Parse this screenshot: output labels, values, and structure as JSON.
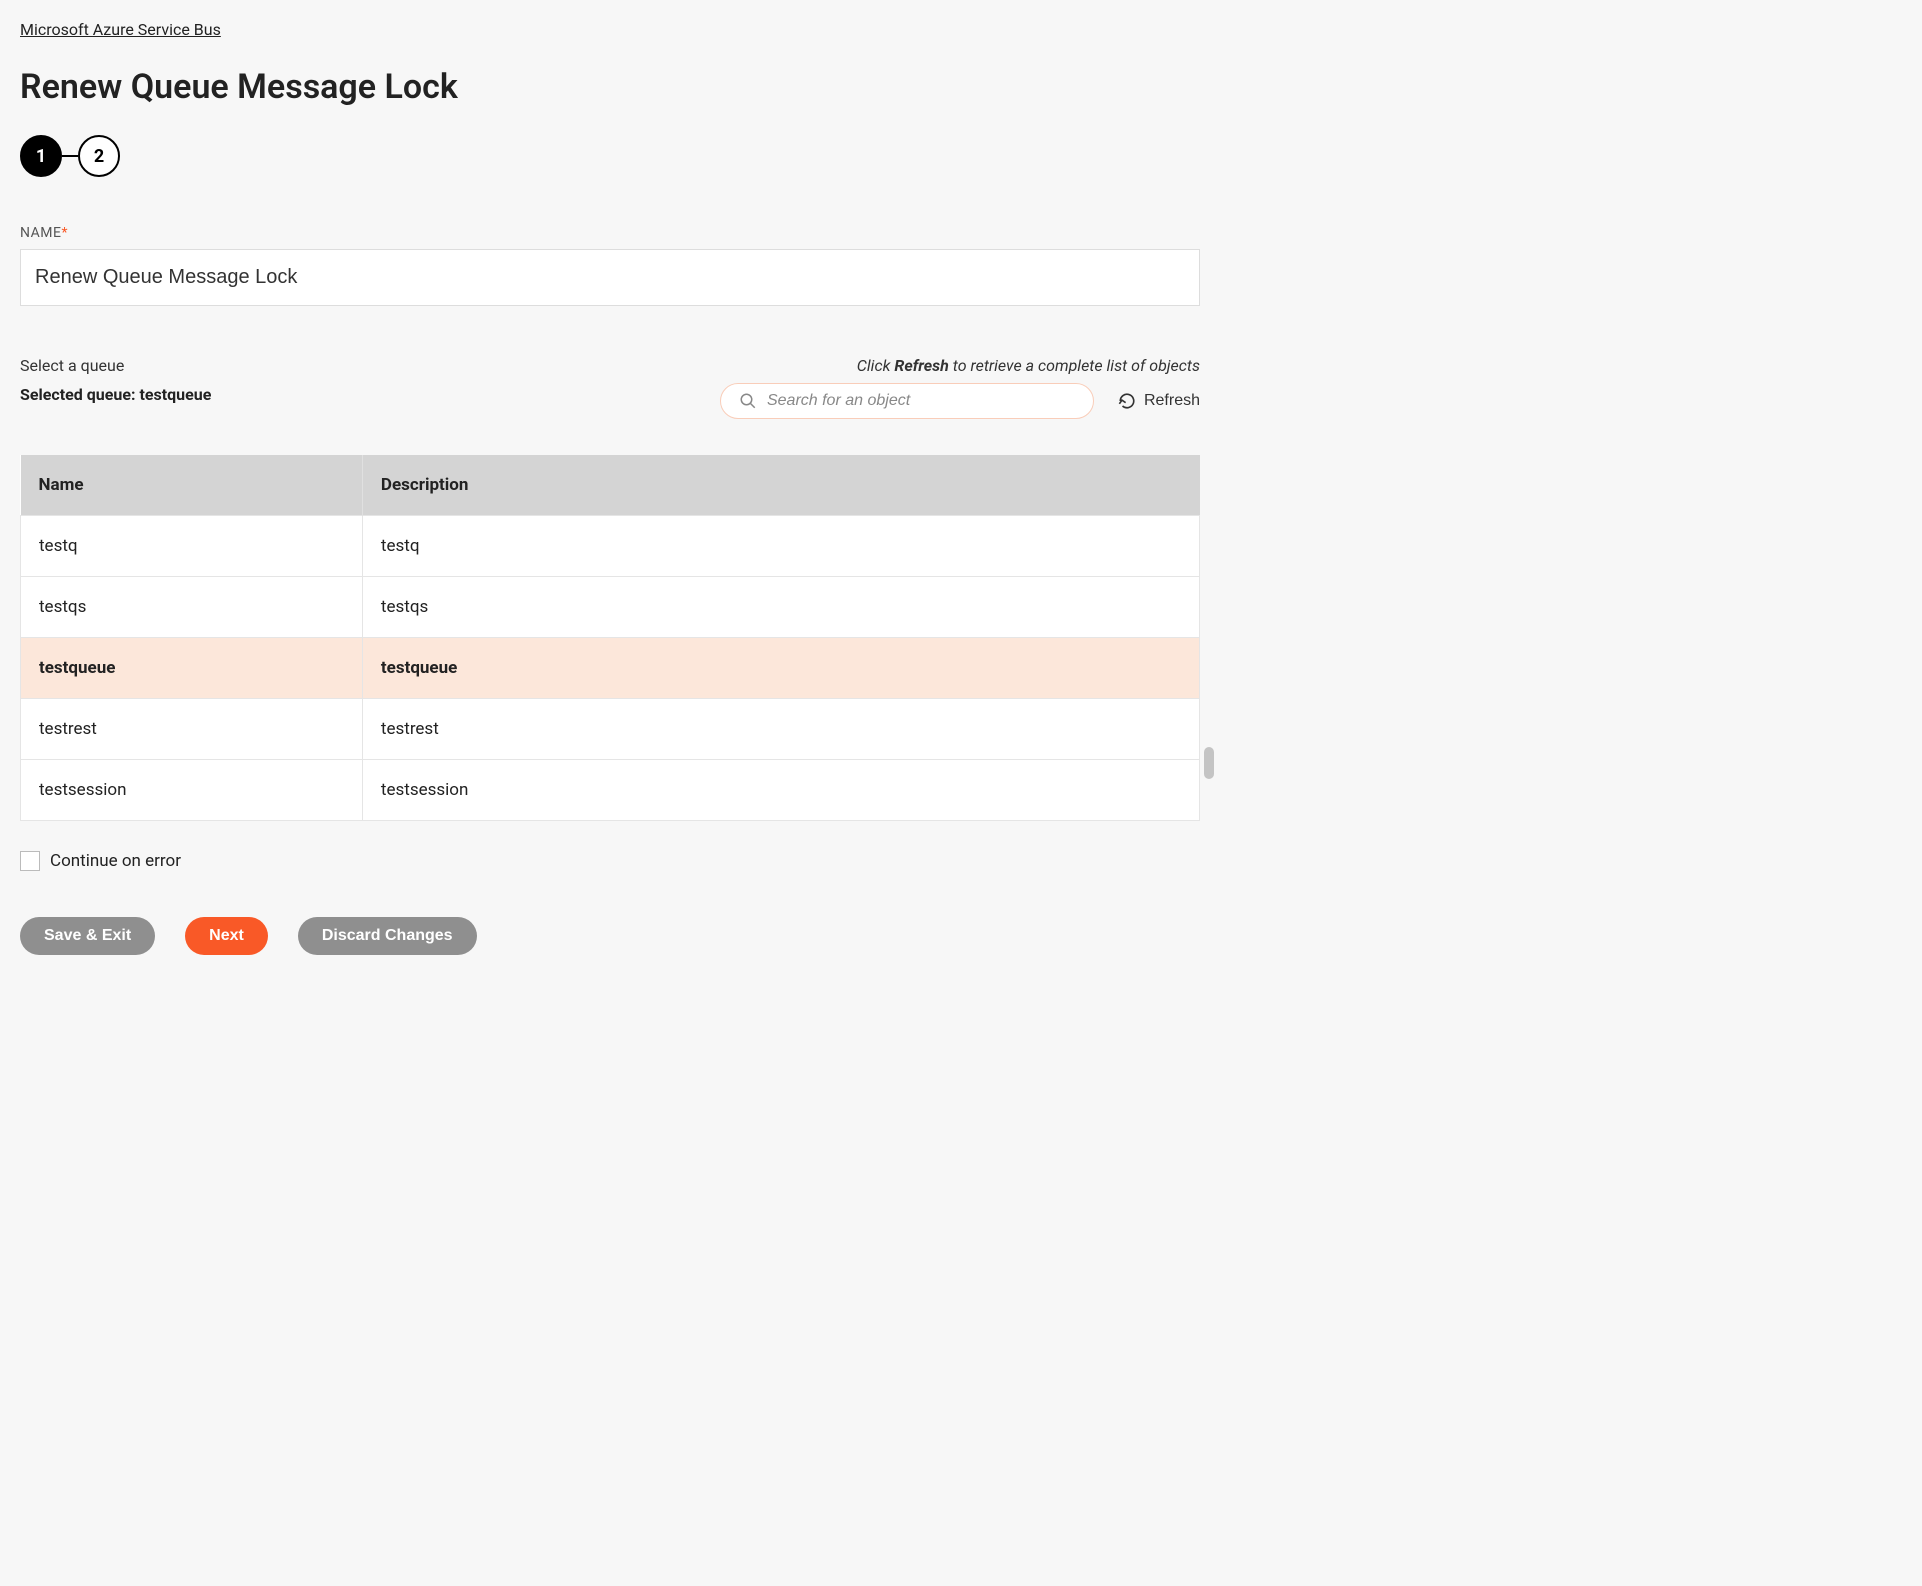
{
  "breadcrumb": "Microsoft Azure Service Bus",
  "page_title": "Renew Queue Message Lock",
  "stepper": {
    "step1": "1",
    "step2": "2"
  },
  "name_field": {
    "label": "NAME",
    "value": "Renew Queue Message Lock"
  },
  "queue": {
    "select_label": "Select a queue",
    "hint_prefix": "Click ",
    "hint_bold": "Refresh",
    "hint_suffix": " to retrieve a complete list of objects",
    "selected_prefix": "Selected queue: ",
    "selected_value": "testqueue",
    "search_placeholder": "Search for an object",
    "refresh_label": "Refresh"
  },
  "table": {
    "col_name": "Name",
    "col_description": "Description",
    "rows": [
      {
        "name": "testq",
        "description": "testq",
        "selected": false
      },
      {
        "name": "testqs",
        "description": "testqs",
        "selected": false
      },
      {
        "name": "testqueue",
        "description": "testqueue",
        "selected": true
      },
      {
        "name": "testrest",
        "description": "testrest",
        "selected": false
      },
      {
        "name": "testsession",
        "description": "testsession",
        "selected": false
      }
    ]
  },
  "continue_on_error": {
    "label": "Continue on error",
    "checked": false
  },
  "buttons": {
    "save_exit": "Save & Exit",
    "next": "Next",
    "discard": "Discard Changes"
  }
}
